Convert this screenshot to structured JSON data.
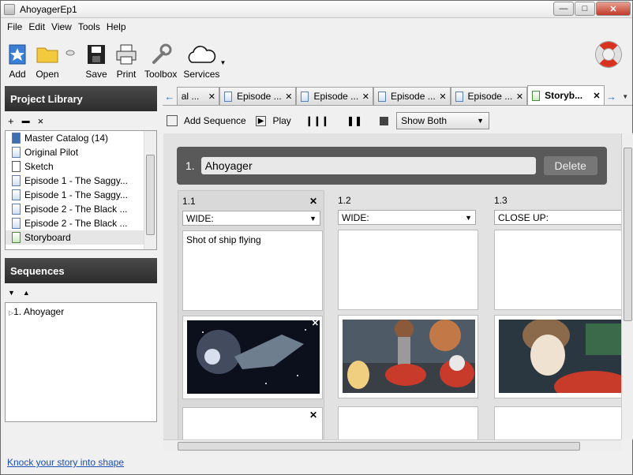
{
  "window": {
    "title": "AhoyagerEp1"
  },
  "menu": [
    "File",
    "Edit",
    "View",
    "Tools",
    "Help"
  ],
  "toolbar": {
    "add": "Add",
    "open": "Open",
    "save": "Save",
    "print": "Print",
    "toolbox": "Toolbox",
    "services": "Services"
  },
  "library": {
    "title": "Project Library",
    "tools": {
      "add": "+",
      "folder": "▬",
      "remove": "×"
    },
    "items": [
      "Master Catalog (14)",
      "Original Pilot",
      "Sketch",
      "Episode 1 - The Saggy...",
      "Episode 1 - The Saggy...",
      "Episode 2 - The Black ...",
      "Episode 2 - The Black ...",
      "Storyboard"
    ]
  },
  "sequences": {
    "title": "Sequences",
    "items": [
      "1. Ahoyager"
    ]
  },
  "footer": {
    "link": "Knock your story into shape"
  },
  "tabs": [
    {
      "label": "al ...",
      "active": false
    },
    {
      "label": "Episode ...",
      "active": false
    },
    {
      "label": "Episode ...",
      "active": false
    },
    {
      "label": "Episode ...",
      "active": false
    },
    {
      "label": "Episode ...",
      "active": false
    },
    {
      "label": "Storyb...",
      "active": true
    }
  ],
  "seq_toolbar": {
    "add_sequence": "Add Sequence",
    "play": "Play",
    "show_mode": "Show Both"
  },
  "sequence": {
    "number": "1.",
    "name": "Ahoyager",
    "delete": "Delete"
  },
  "shots": [
    {
      "number": "1.1",
      "type": "WIDE:",
      "description": "Shot of ship flying"
    },
    {
      "number": "1.2",
      "type": "WIDE:",
      "description": ""
    },
    {
      "number": "1.3",
      "type": "CLOSE UP:",
      "description": ""
    }
  ]
}
